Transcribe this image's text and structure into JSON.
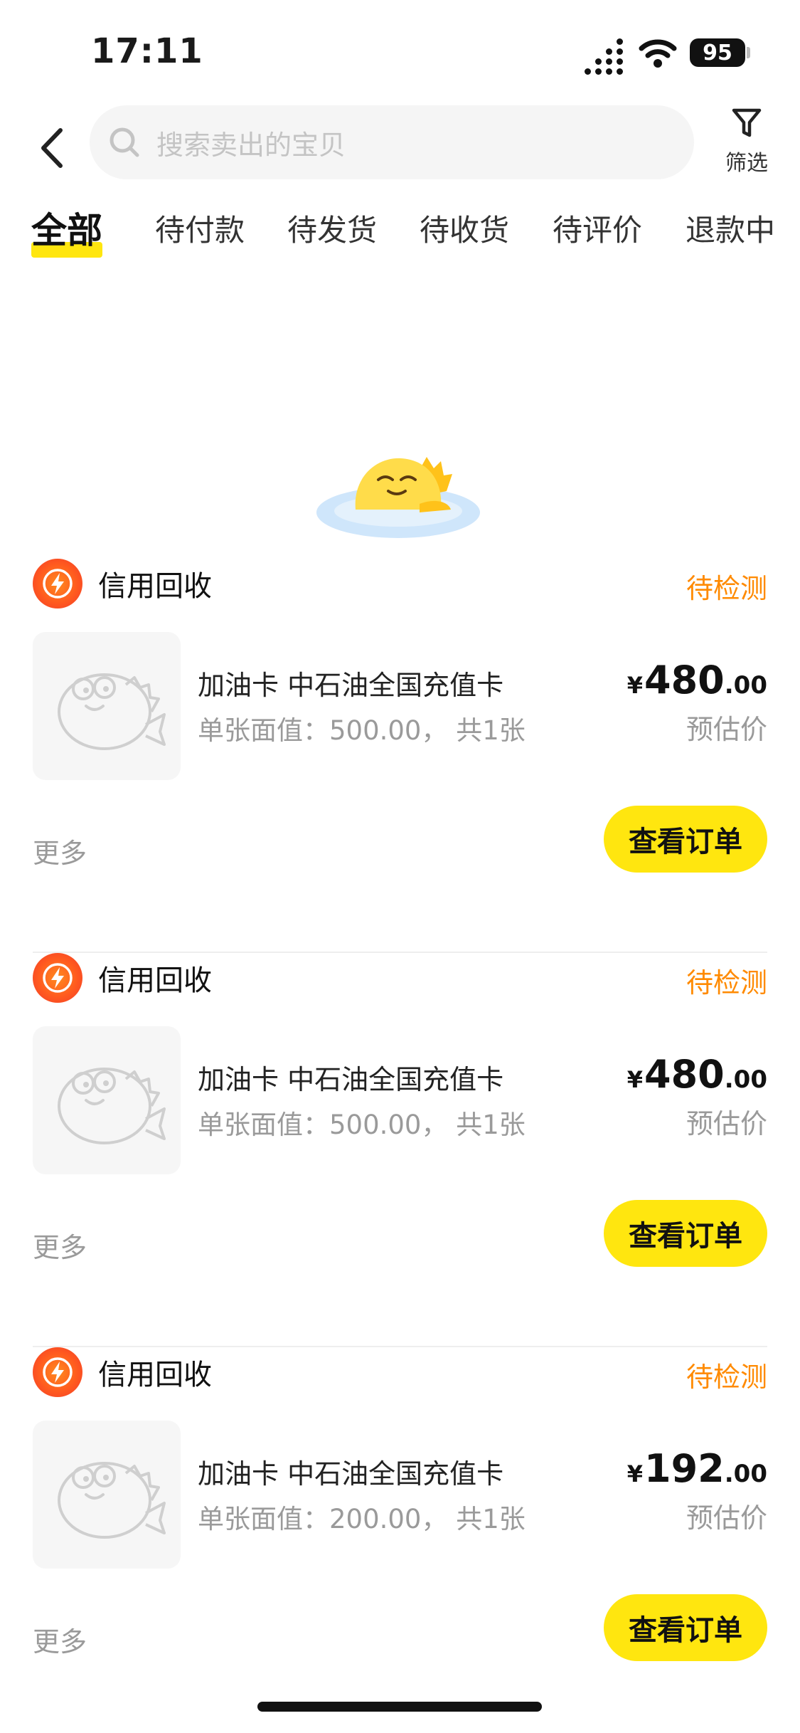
{
  "status_bar": {
    "time": "17:11",
    "battery": "95"
  },
  "nav": {
    "search_placeholder": "搜索卖出的宝贝",
    "filter_label": "筛选"
  },
  "tabs": [
    {
      "label": "全部",
      "active": true
    },
    {
      "label": "待付款",
      "active": false
    },
    {
      "label": "待发货",
      "active": false
    },
    {
      "label": "待收货",
      "active": false
    },
    {
      "label": "待评价",
      "active": false
    },
    {
      "label": "退款中",
      "active": false
    }
  ],
  "orders": [
    {
      "shop_name": "信用回收",
      "status": "待检测",
      "title": "加油卡 中石油全国充值卡",
      "spec": "单张面值：500.00， 共1张",
      "price_currency": "¥",
      "price_int": "480",
      "price_dec": ".00",
      "price_label": "预估价",
      "more": "更多",
      "action": "查看订单"
    },
    {
      "shop_name": "信用回收",
      "status": "待检测",
      "title": "加油卡 中石油全国充值卡",
      "spec": "单张面值：500.00， 共1张",
      "price_currency": "¥",
      "price_int": "480",
      "price_dec": ".00",
      "price_label": "预估价",
      "more": "更多",
      "action": "查看订单"
    },
    {
      "shop_name": "信用回收",
      "status": "待检测",
      "title": "加油卡 中石油全国充值卡",
      "spec": "单张面值：200.00， 共1张",
      "price_currency": "¥",
      "price_int": "192",
      "price_dec": ".00",
      "price_label": "预估价",
      "more": "更多",
      "action": "查看订单"
    }
  ],
  "colors": {
    "accent_yellow": "#ffe60f",
    "status_orange": "#ff8a00",
    "muted_text": "#9a9a9a"
  }
}
